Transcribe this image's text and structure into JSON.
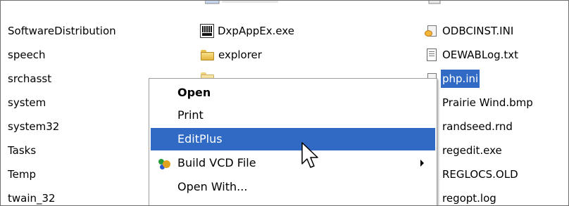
{
  "column1": [
    {
      "label": "SoftwareDistribution"
    },
    {
      "label": "speech"
    },
    {
      "label": "srchasst"
    },
    {
      "label": "system"
    },
    {
      "label": "system32"
    },
    {
      "label": "Tasks"
    },
    {
      "label": "Temp"
    },
    {
      "label": "twain_32"
    }
  ],
  "column2": [
    {
      "label": "DxpAppEx.exe",
      "icon": "exe-icon"
    },
    {
      "label": "explorer",
      "icon": "folder-icon"
    }
  ],
  "column3": [
    {
      "label": "ODBCINST.INI",
      "icon": "ini-file-icon"
    },
    {
      "label": "OEWABLog.txt",
      "icon": "text-file-icon"
    },
    {
      "label": "php.ini",
      "icon": "ini-file-icon",
      "selected": true
    },
    {
      "label": "Prairie Wind.bmp",
      "icon": "bitmap-icon"
    },
    {
      "label": "randseed.rnd",
      "icon": "file-icon"
    },
    {
      "label": "regedit.exe",
      "icon": "regedit-icon"
    },
    {
      "label": "REGLOCS.OLD",
      "icon": "file-icon"
    },
    {
      "label": "regopt.log",
      "icon": "text-file-icon"
    }
  ],
  "context_menu": {
    "items": [
      {
        "label": "Open",
        "bold": true
      },
      {
        "label": "Print"
      },
      {
        "label": "EditPlus",
        "highlighted": true
      },
      {
        "label": "Build VCD File",
        "icon": "vcd-icon",
        "has_submenu": true
      },
      {
        "label": "Open With..."
      }
    ]
  },
  "colors": {
    "selection": "#316ac5",
    "menu_background": "#ffffff"
  }
}
